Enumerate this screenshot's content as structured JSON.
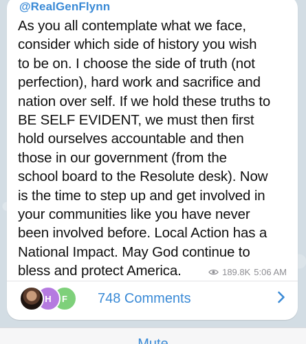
{
  "post": {
    "channel_name": "@RealGenFlynn",
    "text": "As you all contemplate what we face,\nconsider which side of history you wish\nto be on. I choose the side of truth (not\nperfection), hard work and sacrifice and\nnation over self. If we hold these truths to\nBE SELF EVIDENT, we must then first\nhold ourselves accountable and then\nthose in our government (from the\nschool board to the Resolute desk). Now\nis the time to step up and get involved in\nyour communities like you have never\nbeen involved before. Local Action has a\nNational Impact. May God continue to\nbless and protect America.",
    "views": "189.8K",
    "time": "5:06 AM"
  },
  "comments": {
    "label": "748 Comments",
    "avatars": [
      {
        "initials": ""
      },
      {
        "initials": "H"
      },
      {
        "initials": "F"
      }
    ]
  },
  "bottom_bar": {
    "mute_label": "Mute"
  },
  "colors": {
    "accent": "#3a8ad6",
    "background": "#d3dde4",
    "bubble": "#ffffff",
    "meta": "#8e8e93"
  }
}
